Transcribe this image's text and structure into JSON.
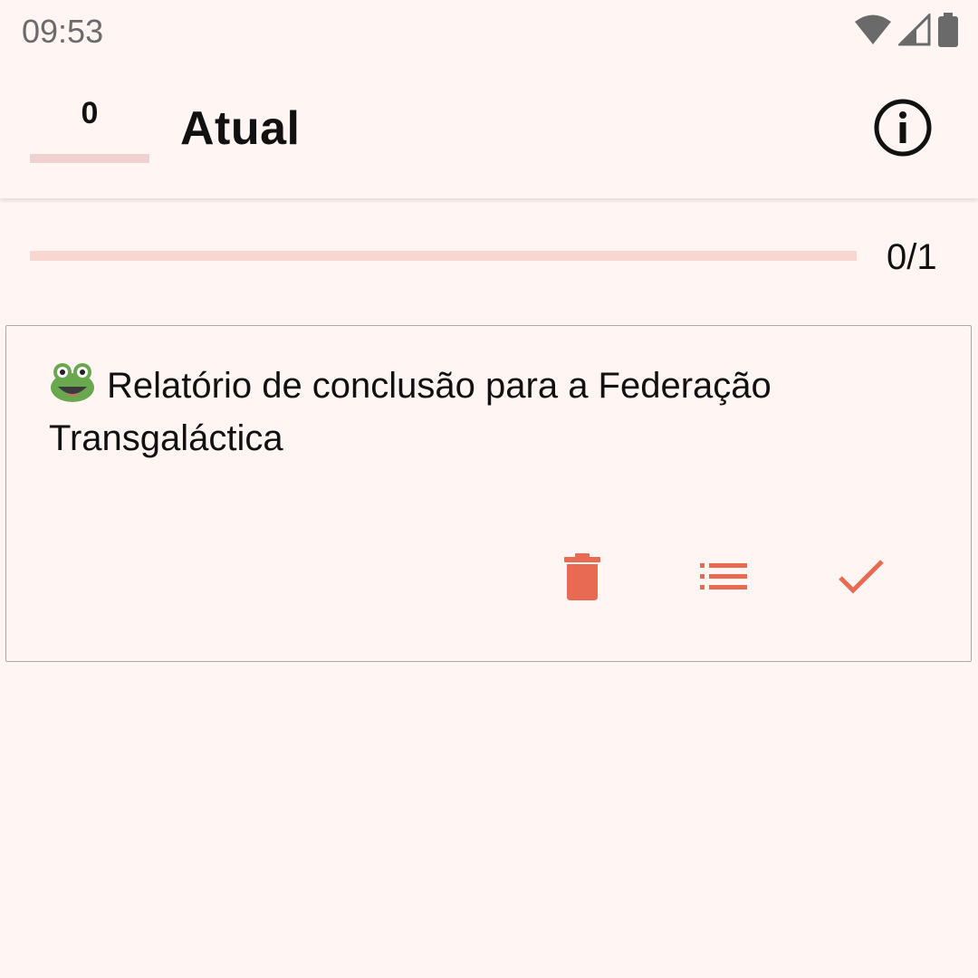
{
  "status_bar": {
    "time": "09:53",
    "icons": [
      "wifi-icon",
      "cell-signal-icon",
      "battery-icon"
    ]
  },
  "app_bar": {
    "counter_value": "0",
    "counter_progress": 0,
    "title": "Atual",
    "info_icon": "info-icon"
  },
  "progress": {
    "label": "0/1",
    "completed": 0,
    "total": 1
  },
  "task": {
    "emoji": "frog-emoji",
    "text": "Relatório de conclusão para a Federação Transgaláctica",
    "actions": [
      {
        "name": "delete",
        "icon": "trash-icon"
      },
      {
        "name": "subtasks",
        "icon": "list-icon"
      },
      {
        "name": "complete",
        "icon": "check-icon"
      }
    ]
  },
  "colors": {
    "background": "#fff6f4",
    "accent": "#e86a52",
    "progress_track": "#f9d6cf",
    "counter_track": "#eed2d2"
  }
}
